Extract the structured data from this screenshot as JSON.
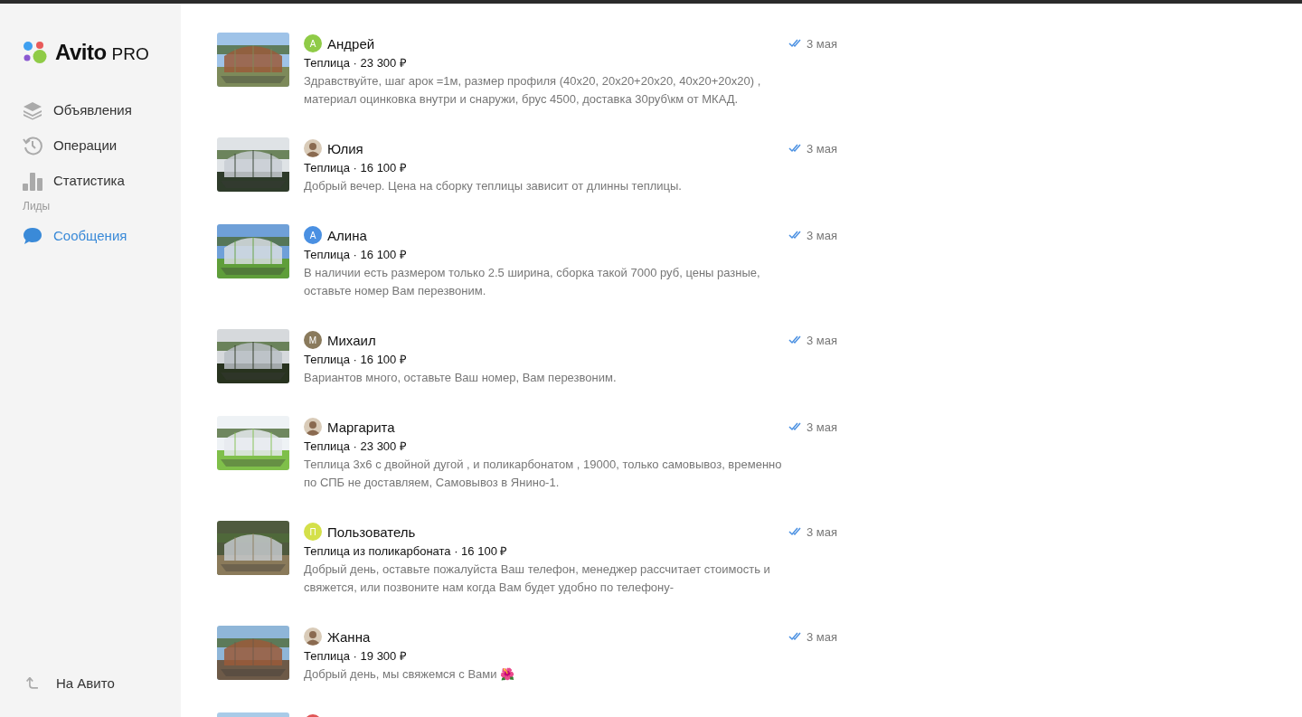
{
  "logo": {
    "brand": "Avito",
    "suffix": "PRO"
  },
  "sidebar": {
    "items": [
      {
        "label": "Объявления",
        "selected": false
      },
      {
        "label": "Операции",
        "selected": false
      },
      {
        "label": "Статистика",
        "selected": false
      }
    ],
    "section": "Лиды",
    "section_items": [
      {
        "label": "Сообщения",
        "selected": true
      }
    ],
    "footer_link": "На Авито"
  },
  "messages": [
    {
      "avatar": {
        "kind": "letter",
        "letter": "А",
        "color": "#8fcb47"
      },
      "name": "Андрей",
      "ad": "Теплица · 23 300 ₽",
      "text": "Здравствуйте, шаг арок =1м, размер профиля (40х20, 20х20+20х20, 40х20+20х20) , материал оцинковка внутри и снаружи, брус 4500, доставка 30руб\\км от МКАД.",
      "read": true,
      "date": "3 мая"
    },
    {
      "name": "Юлия",
      "ad": "Теплица · 16 100 ₽",
      "text": "Добрый вечер. Цена на сборку теплицы зависит от длинны теплицы.",
      "read": true,
      "date": "3 мая"
    },
    {
      "avatar": {
        "kind": "letter",
        "letter": "А",
        "color": "#4a90e2"
      },
      "name": "Алина",
      "ad": "Теплица · 16 100 ₽",
      "text": "В наличии есть размером только 2.5 ширина, сборка такой 7000 руб, цены разные, оставьте номер Вам перезвоним.",
      "read": true,
      "date": "3 мая"
    },
    {
      "avatar": {
        "kind": "letter",
        "letter": "М",
        "color": "#8a7a5c"
      },
      "name": "Михаил",
      "ad": "Теплица · 16 100 ₽",
      "text": "Вариантов много, оставьте Ваш номер, Вам перезвоним.",
      "read": true,
      "date": "3 мая"
    },
    {
      "name": "Маргарита",
      "ad": "Теплица · 23 300 ₽",
      "text": "Теплица 3х6 с двойной дугой , и поликарбонатом , 19000, только самовывоз, временно по СПБ не доставляем, Самовывоз в Янино-1.",
      "read": true,
      "date": "3 мая"
    },
    {
      "avatar": {
        "kind": "letter",
        "letter": "П",
        "color": "#d4e04a"
      },
      "name": "Пользователь",
      "ad": "Теплица из поликарбоната · 16 100 ₽",
      "text": "Добрый день, оставьте пожалуйста Ваш телефон, менеджер рассчитает стоимость и свяжется, или позвоните нам когда Вам будет удобно по телефону-",
      "read": true,
      "date": "3 мая"
    },
    {
      "name": "Жанна",
      "ad": "Теплица · 19 300 ₽",
      "text": "Добрый день, мы свяжемся с Вами 🌺",
      "read": true,
      "date": "3 мая"
    },
    {
      "avatar": {
        "kind": "dot",
        "color": "#e05555"
      }
    }
  ]
}
